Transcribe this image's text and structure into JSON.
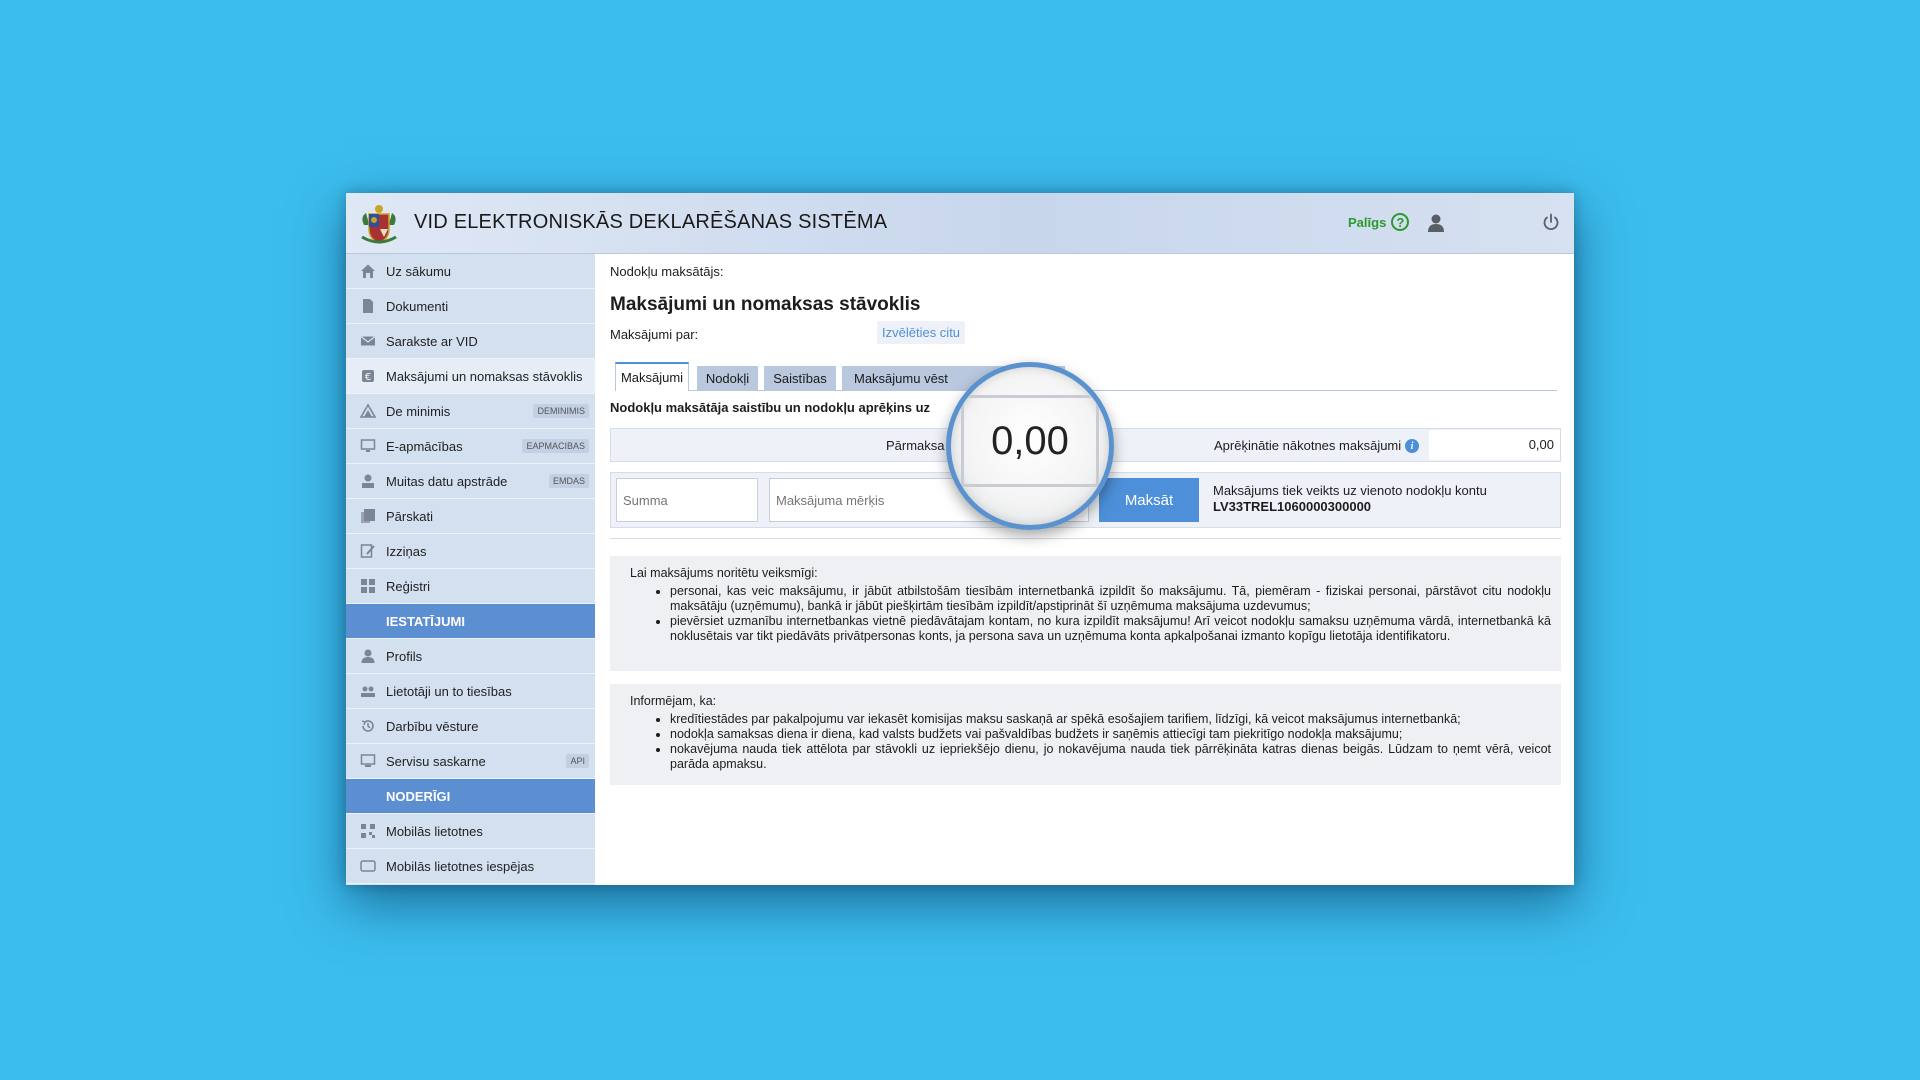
{
  "header": {
    "title": "VID ELEKTRONISKĀS DEKLARĒŠANAS SISTĒMA",
    "help_label": "Palīgs",
    "help_icon": "?"
  },
  "sidebar": {
    "items": [
      {
        "label": "Uz sākumu",
        "icon": "home-icon"
      },
      {
        "label": "Dokumenti",
        "icon": "document-icon"
      },
      {
        "label": "Sarakste ar VID",
        "icon": "envelope-icon"
      },
      {
        "label": "Maksājumi un nomaksas stāvoklis",
        "icon": "payment-icon",
        "active": true
      },
      {
        "label": "De minimis",
        "icon": "de-minimis-icon",
        "badge": "DEMINIMIS"
      },
      {
        "label": "E-apmācības",
        "icon": "elearning-icon",
        "badge": "EAPMACIBAS"
      },
      {
        "label": "Muitas datu apstrāde",
        "icon": "customs-icon",
        "badge": "EMDAS"
      },
      {
        "label": "Pārskati",
        "icon": "reports-icon"
      },
      {
        "label": "Izziņas",
        "icon": "certificate-icon"
      },
      {
        "label": "Reģistri",
        "icon": "registers-icon"
      }
    ],
    "section_settings": "IESTATĪJUMI",
    "settings_items": [
      {
        "label": "Profils",
        "icon": "profile-icon"
      },
      {
        "label": "Lietotāji un to tiesības",
        "icon": "users-icon"
      },
      {
        "label": "Darbību vēsture",
        "icon": "history-icon"
      },
      {
        "label": "Servisu saskarne",
        "icon": "api-icon",
        "badge": "API"
      }
    ],
    "section_useful": "NODERĪGI",
    "useful_items": [
      {
        "label": "Mobilās lietotnes",
        "icon": "qr-icon"
      },
      {
        "label": "Mobilās lietotnes iespējas",
        "icon": "mobile-icon"
      }
    ]
  },
  "main": {
    "payer_label": "Nodokļu maksātājs:",
    "title": "Maksājumi un nomaksas stāvoklis",
    "pay_for_label": "Maksājumi par:",
    "choose_other": "Izvēlēties citu",
    "tabs": [
      {
        "label": "Maksājumi",
        "active": true
      },
      {
        "label": "Nodokļi"
      },
      {
        "label": "Saistības"
      },
      {
        "label": "Maksājumu vēst"
      },
      {
        "label": "s stāvoklis"
      }
    ],
    "section_title": "Nodokļu maksātāja saistību un nodokļu aprēķins uz",
    "overpayment_label": "Pārmaksa",
    "overpayment_value": "0,00",
    "future_payments_label": "Aprēķinātie nākotnes maksājumi",
    "future_payments_value": "0,00",
    "sum_placeholder": "Summa",
    "purpose_placeholder": "Maksājuma mērķis",
    "pay_button": "Maksāt",
    "pay_note": "Maksājums tiek veikts uz vienoto nodokļu kontu",
    "account": "LV33TREL1060000300000",
    "box1": {
      "title": "Lai maksājums noritētu veiksmīgi:",
      "items": [
        "personai, kas veic maksājumu, ir jābūt atbilstošām tiesībām internetbankā izpildīt šo maksājumu. Tā, piemēram - fiziskai personai, pārstāvot citu nodokļu maksātāju (uzņēmumu), bankā ir jābūt piešķirtām tiesībām izpildīt/apstiprināt šī uzņēmuma maksājuma uzdevumus;",
        "pievērsiet uzmanību internetbankas vietnē piedāvātajam kontam, no kura izpildīt maksājumu! Arī veicot nodokļu samaksu uzņēmuma vārdā, internetbankā kā noklusētais var tikt piedāvāts privātpersonas konts, ja persona sava un uzņēmuma konta apkalpošanai izmanto kopīgu lietotāja identifikatoru."
      ]
    },
    "box2": {
      "title": "Informējam, ka:",
      "items": [
        "kredītiestādes par pakalpojumu var iekasēt komisijas maksu saskaņā ar spēkā esošajiem tarifiem, līdzīgi, kā veicot maksājumus internetbankā;",
        "nodokļa samaksas diena ir diena, kad valsts budžets vai pašvaldības budžets ir saņēmis attiecīgi tam piekritīgo nodokļa maksājumu;",
        "nokavējuma nauda tiek attēlota par stāvokli uz iepriekšējo dienu, jo nokavējuma nauda tiek pārrēķināta katras dienas beigās. Lūdzam to ņemt vērā, veicot parāda apmaksu."
      ]
    }
  },
  "colors": {
    "background": "#3bbdee",
    "sidebar": "#d3e0f0",
    "section": "#5c8fd1",
    "accent": "#4d8fd8",
    "help_green": "#2a9b2a"
  }
}
